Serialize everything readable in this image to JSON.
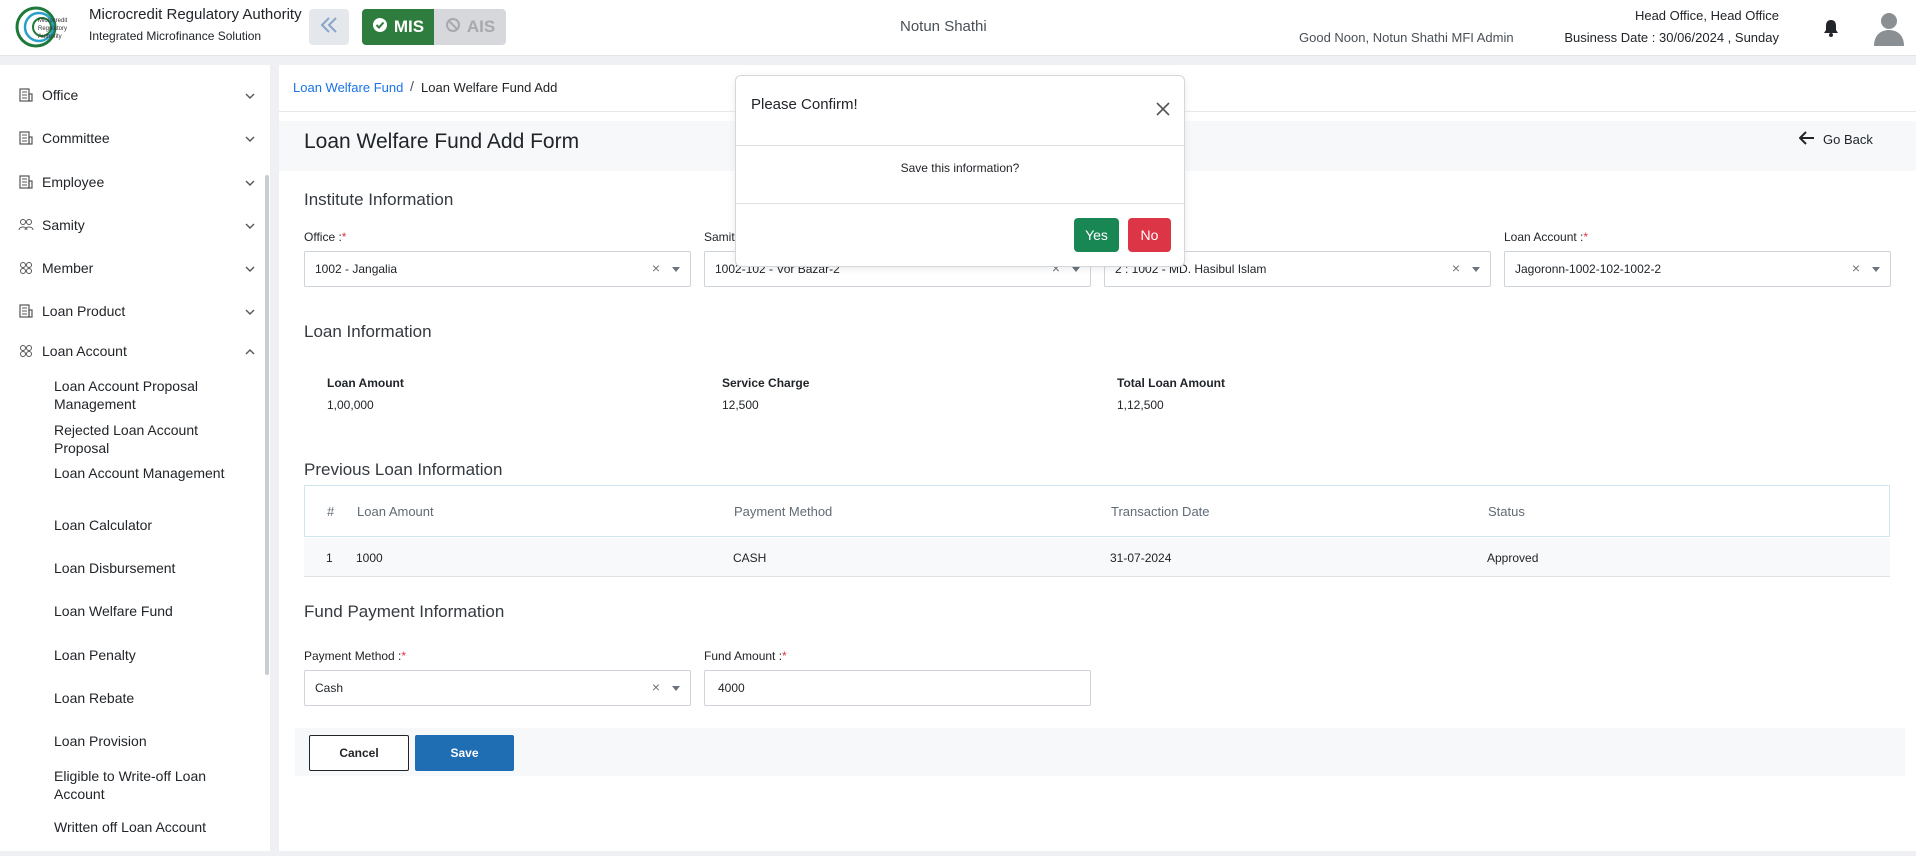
{
  "header": {
    "org_name": "Microcredit Regulatory Authority",
    "org_sub": "Integrated Microfinance Solution",
    "logo_text": "Microcredit Regulatory Authority",
    "mode_mis": "MIS",
    "mode_ais": "AIS",
    "center_title": "Notun Shathi",
    "greeting": "Good Noon, Notun Shathi MFI Admin",
    "head_office": "Head Office, Head Office",
    "business_date": "Business Date : 30/06/2024 , Sunday",
    "accent_green": "#2f7d3e"
  },
  "sidebar": {
    "items": [
      {
        "label": "Office",
        "icon": "building-icon"
      },
      {
        "label": "Committee",
        "icon": "building-icon"
      },
      {
        "label": "Employee",
        "icon": "building-icon"
      },
      {
        "label": "Samity",
        "icon": "group-icon"
      },
      {
        "label": "Member",
        "icon": "users-icon"
      },
      {
        "label": "Loan Product",
        "icon": "building-icon"
      },
      {
        "label": "Loan Account",
        "icon": "users-icon"
      }
    ],
    "sub_items": [
      "Loan Account Proposal Management",
      "Rejected Loan Account Proposal",
      "Loan Account Management",
      "Loan Calculator",
      "Loan Disbursement",
      "Loan Welfare Fund",
      "Loan Penalty",
      "Loan Rebate",
      "Loan Provision",
      "Eligible to Write-off Loan Account",
      "Written off Loan Account"
    ]
  },
  "breadcrumb": {
    "parent": "Loan Welfare Fund",
    "separator": "/",
    "current": "Loan Welfare Fund Add"
  },
  "form": {
    "title": "Loan Welfare Fund Add Form",
    "go_back": "Go Back",
    "institute_title": "Institute Information",
    "office_label": "Office :",
    "office_value": "1002 - Jangalia",
    "samity_label": "Samit",
    "samity_value": "1002-102 - Vor Bazar-2",
    "member_value": "2 : 1002 - MD. Hasibul Islam",
    "loan_account_label": "Loan Account :",
    "loan_account_value": "Jagoronn-1002-102-1002-2",
    "required_mark": "*",
    "clear_mark": "×",
    "loan_info_title": "Loan Information",
    "loan_amount_label": "Loan Amount",
    "loan_amount_value": "1,00,000",
    "service_charge_label": "Service Charge",
    "service_charge_value": "12,500",
    "total_loan_label": "Total Loan Amount",
    "total_loan_value": "1,12,500",
    "prev_loan_title": "Previous Loan Information",
    "table": {
      "headers": [
        "#",
        "Loan Amount",
        "Payment Method",
        "Transaction Date",
        "Status"
      ],
      "rows": [
        [
          "1",
          "1000",
          "CASH",
          "31-07-2024",
          "Approved"
        ]
      ]
    },
    "fund_payment_title": "Fund Payment Information",
    "payment_method_label": "Payment Method :",
    "payment_method_value": "Cash",
    "fund_amount_label": "Fund Amount :",
    "fund_amount_value": "4000",
    "cancel_label": "Cancel",
    "save_label": "Save"
  },
  "modal": {
    "title": "Please Confirm!",
    "body": "Save this information?",
    "yes_label": "Yes",
    "no_label": "No"
  }
}
